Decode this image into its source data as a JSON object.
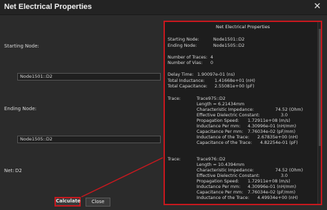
{
  "window": {
    "title": "Net Electrical Properties",
    "close_glyph": "✕"
  },
  "form": {
    "starting_node_label": "Starting Node:",
    "starting_node_value": "Node1501::D2",
    "ending_node_label": "Ending Node:",
    "ending_node_value": "Node1505::D2",
    "net_label": "Net:",
    "net_value": "D2"
  },
  "results": {
    "heading": "Net Electrical Properties",
    "starting_label": "Starting Node:",
    "starting_value": "Node1501::D2",
    "ending_label": "Ending Node:",
    "ending_value": "Node1505::D2",
    "traces_label": "Number of Traces:",
    "traces_value": "4",
    "vias_label": "Number of Vias:",
    "vias_value": "0",
    "delay_label": "Delay Time:",
    "delay_value": "1.90097e-01 (ns)",
    "ind_label": "Total Inductance:",
    "ind_value": "1.41668e+01 (nH)",
    "cap_label": "Total Capacitance:",
    "cap_value": "2.55081e+00 (pF)",
    "trace_word": "Trace:",
    "traces": [
      {
        "name": "Trace975::D2",
        "length": "Length = 6.21434mm",
        "rows": [
          {
            "label": "Characteristic Impedance:",
            "value": "74.52 (Ohm)"
          },
          {
            "label": "Effective Dielectric Constant:",
            "value": "3.0"
          },
          {
            "label": "Propagation Speed:",
            "value": "1.72911e+08 (m/s)"
          },
          {
            "label": "Inductance Per mm:",
            "value": "4.30996e-01 (nH/mm)"
          },
          {
            "label": "Capacitance Per mm:",
            "value": "7.76034e-02 (pF/mm)"
          },
          {
            "label": "Inductance of the Trace:",
            "value": "2.67835e+00 (nH)"
          },
          {
            "label": "Capacitance of the Trace:",
            "value": "4.82254e-01 (pF)"
          }
        ]
      },
      {
        "name": "Trace976::D2",
        "length": "Length = 10.4394mm",
        "rows": [
          {
            "label": "Characteristic Impedance:",
            "value": "74.52 (Ohm)"
          },
          {
            "label": "Effective Dielectric Constant:",
            "value": "3.0"
          },
          {
            "label": "Propagation Speed:",
            "value": "1.72911e+08 (m/s)"
          },
          {
            "label": "Inductance Per mm:",
            "value": "4.30996e-01 (nH/mm)"
          },
          {
            "label": "Capacitance Per mm:",
            "value": "7.76034e-02 (pF/mm)"
          },
          {
            "label": "Inductance of the Trace:",
            "value": "4.49934e+00 (nH)"
          }
        ]
      }
    ]
  },
  "buttons": {
    "calculate": "Calculate",
    "close": "Close"
  },
  "colors": {
    "highlight": "#c8181e",
    "background": "#2b2b2b"
  }
}
